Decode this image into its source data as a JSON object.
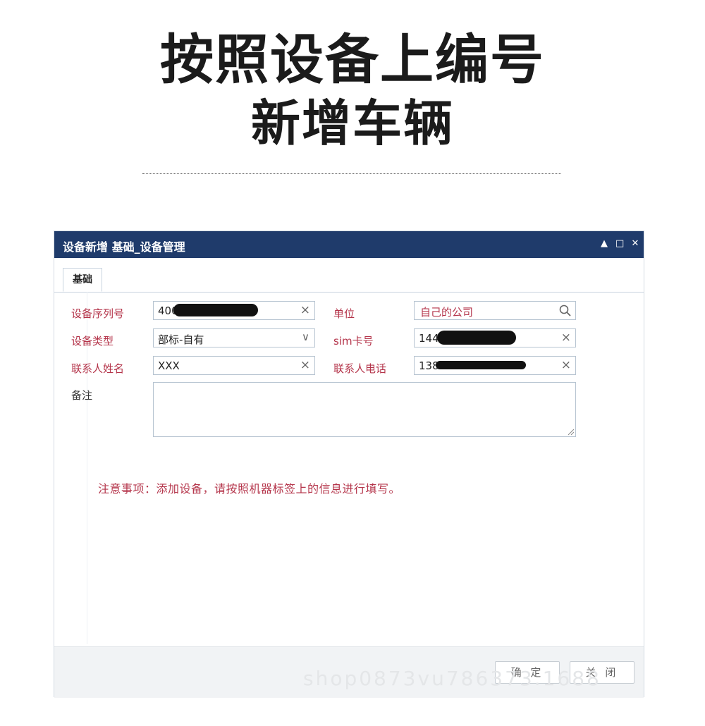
{
  "headline": {
    "line1": "按照设备上编号",
    "line2": "新增车辆"
  },
  "window": {
    "title": "设备新增 基础_设备管理",
    "controls": {
      "collapse": "▲",
      "maximize": "□",
      "close": "✕"
    }
  },
  "tabs": [
    {
      "label": "基础",
      "active": true
    }
  ],
  "form": {
    "serial_label": "设备序列号",
    "serial_value": "400",
    "unit_label": "单位",
    "unit_value": "自己的公司",
    "type_label": "设备类型",
    "type_value": "部标-自有",
    "sim_label": "sim卡号",
    "sim_value": "144",
    "contact_label": "联系人姓名",
    "contact_value": "XXX",
    "phone_label": "联系人电话",
    "phone_value": "138",
    "remark_label": "备注",
    "remark_value": ""
  },
  "note": "注意事项：添加设备，请按照机器标签上的信息进行填写。",
  "buttons": {
    "confirm": "确 定",
    "close": "关 闭"
  },
  "watermark": "shop0873vu786373.1688",
  "colors": {
    "titlebar": "#1f3b6b",
    "required_label": "#b4344a"
  }
}
